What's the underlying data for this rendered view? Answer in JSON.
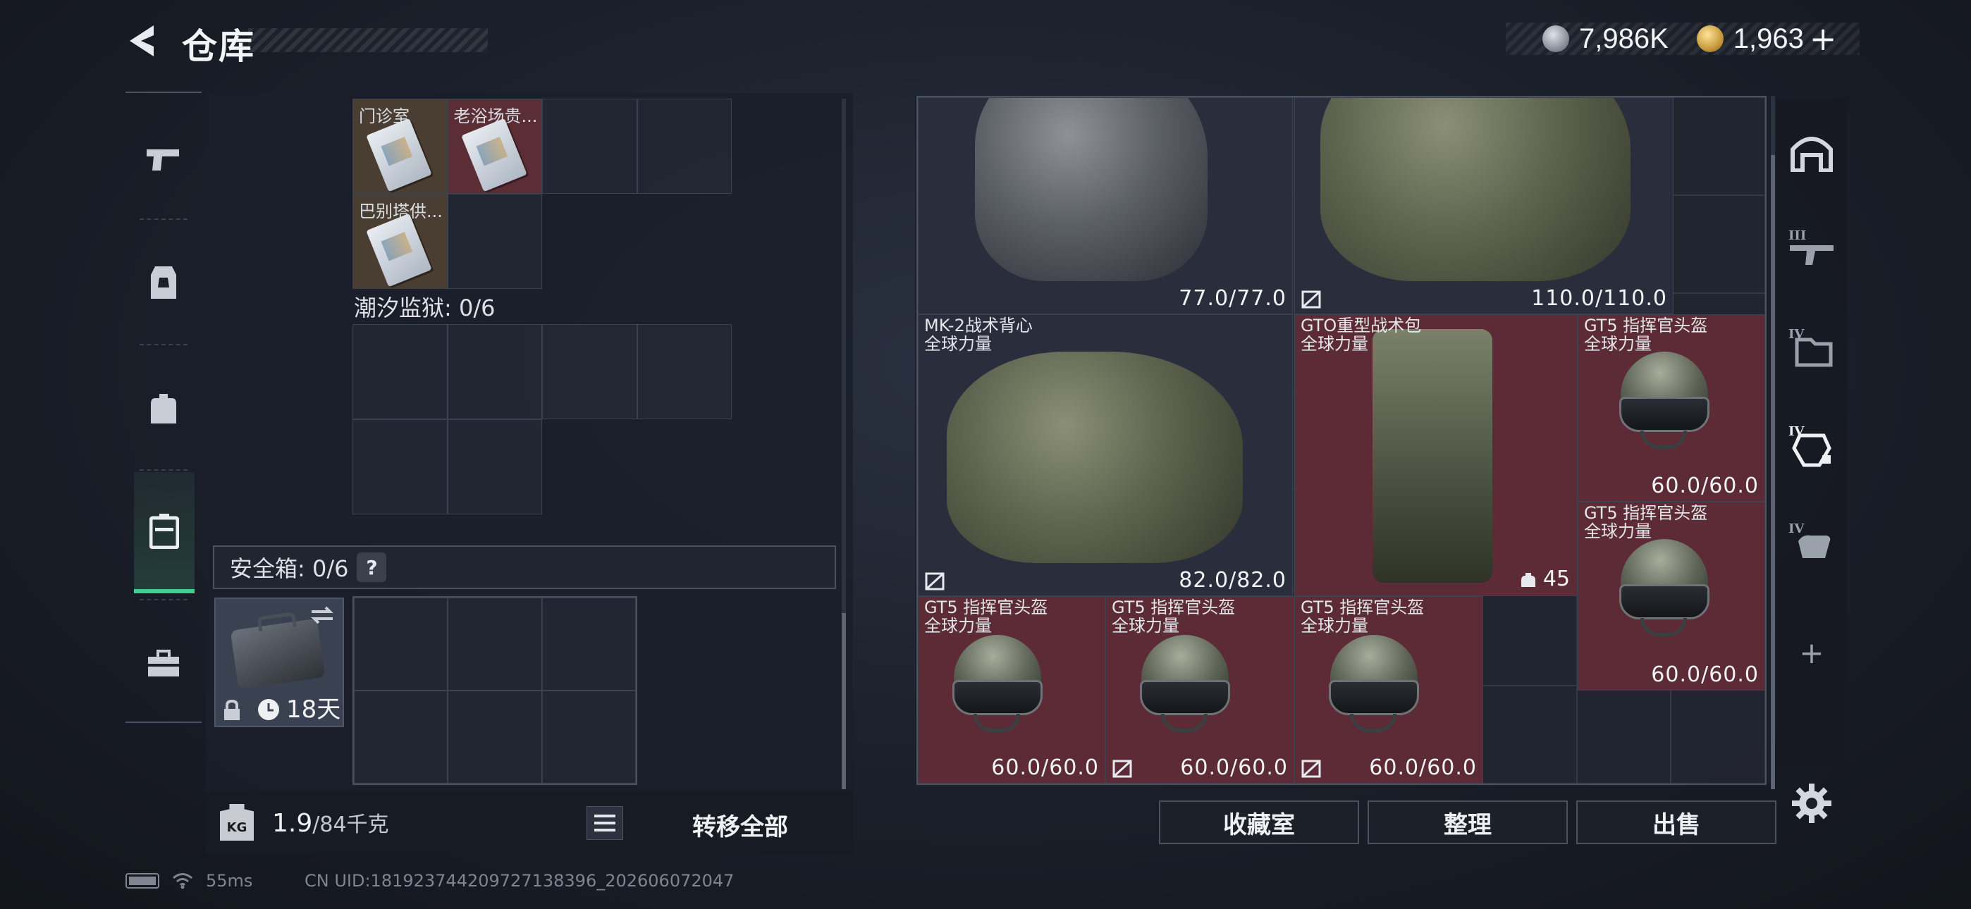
{
  "header": {
    "title": "仓库",
    "currency": [
      {
        "icon": "silver-coin-icon",
        "value": "7,986K"
      },
      {
        "icon": "gold-coin-icon",
        "value": "1,963"
      }
    ],
    "add_currency_label": "+"
  },
  "left_nav": {
    "items": [
      {
        "name": "weapons",
        "icon": "pistol-icon"
      },
      {
        "name": "armor",
        "icon": "vest-icon"
      },
      {
        "name": "backpack",
        "icon": "backpack-icon"
      },
      {
        "name": "containers",
        "icon": "case-icon",
        "active": true
      },
      {
        "name": "toolbox",
        "icon": "toolbox-icon"
      }
    ]
  },
  "left_panel": {
    "keycards": [
      {
        "label": "门诊室",
        "color": "brown"
      },
      {
        "label": "老浴场贵...",
        "color": "red"
      },
      {
        "label": "巴别塔供...",
        "color": "brown"
      }
    ],
    "prison_label": "潮汐监狱: 0/6",
    "safe_box_label": "安全箱: 0/6",
    "safe_box_help": "?",
    "safe_box_timer": "18天",
    "weight_current": "1.9",
    "weight_max": "/84千克",
    "weight_icon_text": "KG",
    "transfer_all": "转移全部"
  },
  "right_panel": {
    "items": [
      {
        "name": "",
        "subtitle": "",
        "durability": "77.0/77.0"
      },
      {
        "name": "",
        "subtitle": "",
        "durability": "110.0/110.0"
      },
      {
        "name": "MK-2战术背心",
        "subtitle": "全球力量",
        "durability": "82.0/82.0"
      },
      {
        "name": "GTO重型战术包",
        "subtitle": "全球力量",
        "count": "45"
      },
      {
        "name": "GT5 指挥官头盔",
        "subtitle": "全球力量",
        "durability": "60.0/60.0"
      },
      {
        "name": "GT5 指挥官头盔",
        "subtitle": "全球力量",
        "durability": "60.0/60.0"
      },
      {
        "name": "GT5 指挥官头盔",
        "subtitle": "全球力量",
        "durability": "60.0/60.0"
      },
      {
        "name": "GT5 指挥官头盔",
        "subtitle": "全球力量",
        "durability": "60.0/60.0"
      },
      {
        "name": "GT5 指挥官头盔",
        "subtitle": "全球力量",
        "durability": "60.0/60.0"
      }
    ],
    "buttons": {
      "collection": "收藏室",
      "sort": "整理",
      "sell": "出售"
    },
    "right_nav": [
      {
        "icon": "bunker-icon"
      },
      {
        "icon": "tier3-rifle-icon",
        "tier": "III"
      },
      {
        "icon": "tier4-folder-icon",
        "tier": "IV"
      },
      {
        "icon": "tier4-vest-icon",
        "tier": "IV"
      },
      {
        "icon": "tier4-hand-icon",
        "tier": "IV"
      },
      {
        "icon": "plus-icon",
        "label": "+"
      }
    ]
  },
  "status_bar": {
    "ping": "55ms",
    "uid": "CN UID:181923744209727138396_202606072047"
  }
}
